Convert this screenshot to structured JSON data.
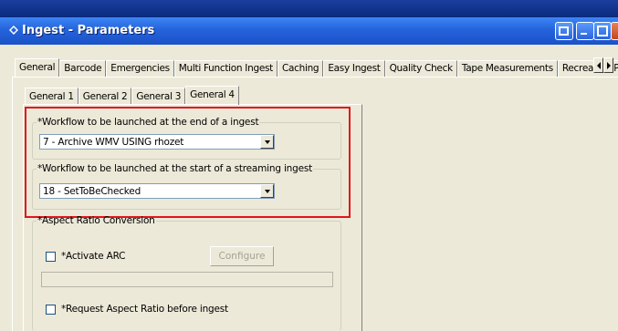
{
  "window": {
    "title": "Ingest - Parameters"
  },
  "main_tabs": [
    {
      "label": "General"
    },
    {
      "label": "Barcode"
    },
    {
      "label": "Emergencies"
    },
    {
      "label": "Multi Function Ingest"
    },
    {
      "label": "Caching"
    },
    {
      "label": "Easy Ingest"
    },
    {
      "label": "Quality Check"
    },
    {
      "label": "Tape Measurements"
    },
    {
      "label": "Recreating Proxy"
    }
  ],
  "sub_tabs": [
    {
      "label": "General 1"
    },
    {
      "label": "General 2"
    },
    {
      "label": "General 3"
    },
    {
      "label": "General 4"
    }
  ],
  "workflow_end": {
    "legend": "*Workflow to be launched at the end of a ingest",
    "value": "7 - Archive WMV USING rhozet"
  },
  "workflow_start": {
    "legend": "*Workflow to be launched at the start of a streaming ingest",
    "value": "18 - SetToBeChecked"
  },
  "arc": {
    "legend": "*Aspect Ratio Conversion",
    "activate_label": "*Activate ARC",
    "configure_label": "Configure",
    "request_label": "*Request Aspect Ratio before ingest"
  },
  "colors": {
    "titlebar": "#2563db",
    "highlight": "#e0161c",
    "face": "#ece9d8"
  }
}
